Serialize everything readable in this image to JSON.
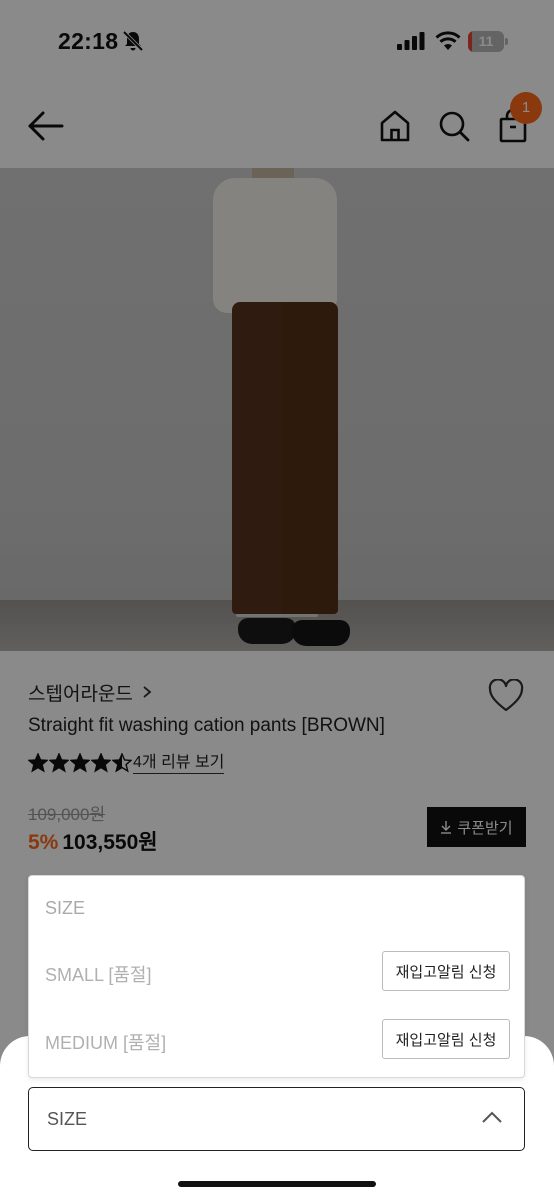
{
  "status_bar": {
    "time": "22:18",
    "battery": "11",
    "battery_level": 0.11,
    "icons": [
      "bell-slash-icon",
      "cellular-signal-icon",
      "wifi-icon",
      "battery-icon"
    ]
  },
  "header": {
    "icons": [
      "back-arrow-icon",
      "home-icon",
      "search-icon",
      "shopping-bag-icon"
    ],
    "cart_count": "1",
    "badge_color": "#ff6a1a"
  },
  "product": {
    "brand": "스텝어라운드",
    "title": "Straight fit washing cation pants [BROWN]",
    "rating": 4.5,
    "review_link": "4개 리뷰 보기",
    "original_price": "109,000원",
    "discount": "5%",
    "sale_price": "103,550원",
    "coupon_label": "쿠폰받기",
    "accent_color": "#ff6a1a"
  },
  "option_panel": {
    "header": "SIZE",
    "options": [
      {
        "label": "SMALL [품절]",
        "action": "재입고알림 신청"
      },
      {
        "label": "MEDIUM [품절]",
        "action": "재입고알림 신청"
      }
    ]
  },
  "size_select": {
    "label": "SIZE"
  }
}
